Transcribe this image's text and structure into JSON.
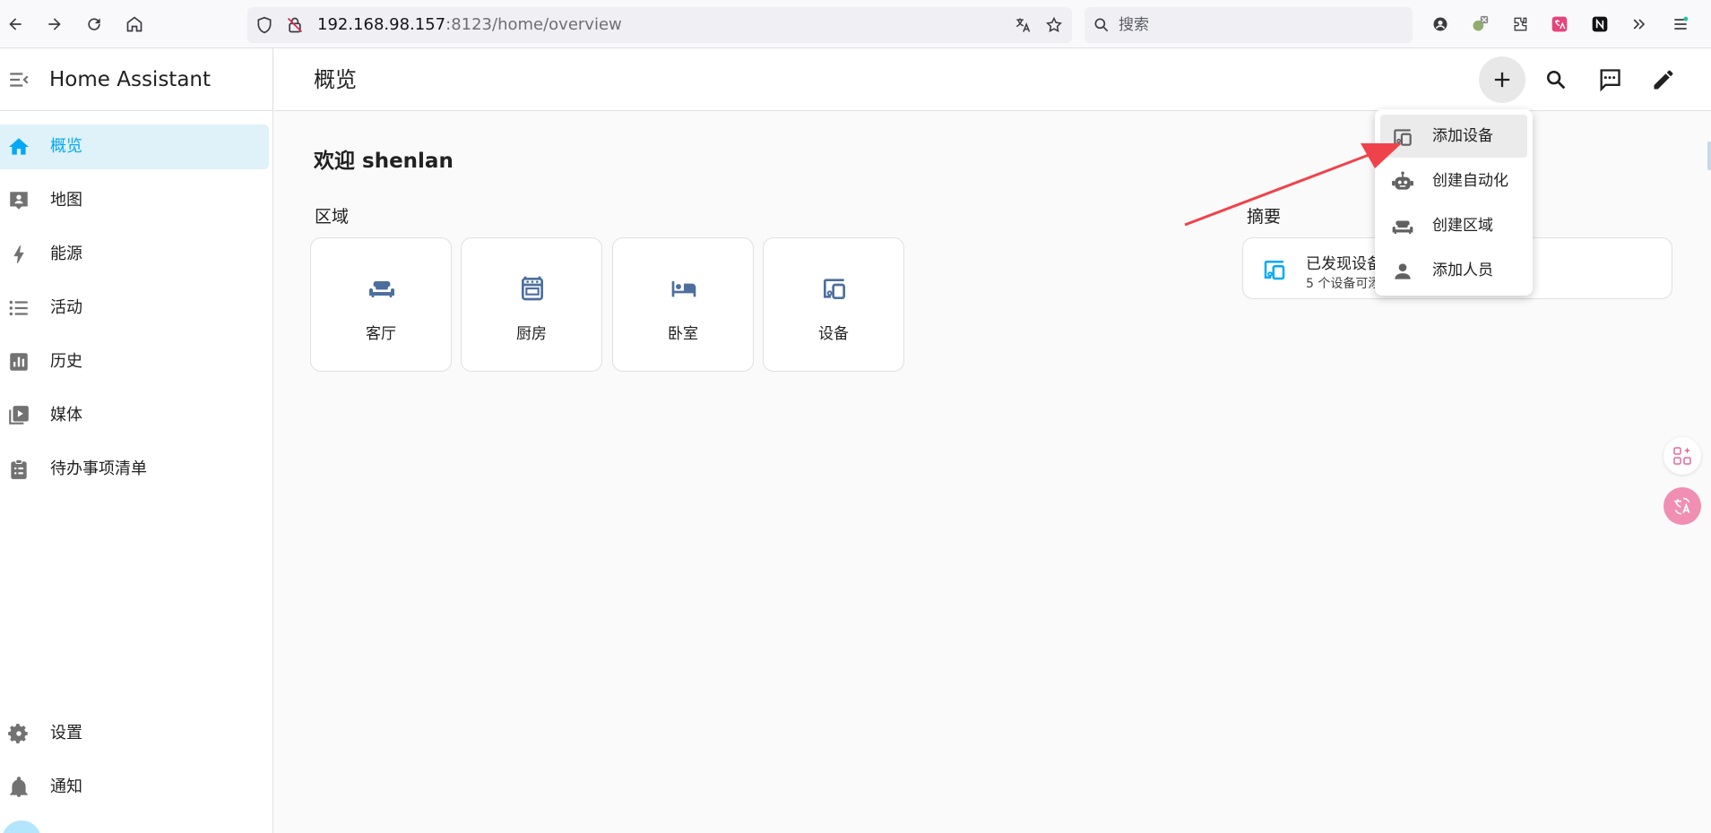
{
  "browser": {
    "url_host": "192.168.98.157",
    "url_path": ":8123/home/overview",
    "search_placeholder": "搜索"
  },
  "sidebar": {
    "title": "Home Assistant",
    "items": [
      {
        "label": "概览",
        "icon": "home-icon",
        "active": true
      },
      {
        "label": "地图",
        "icon": "map-account-icon"
      },
      {
        "label": "能源",
        "icon": "lightning-bolt-icon"
      },
      {
        "label": "活动",
        "icon": "format-list-bulleted-icon"
      },
      {
        "label": "历史",
        "icon": "chart-box-icon"
      },
      {
        "label": "媒体",
        "icon": "play-box-multiple-icon"
      },
      {
        "label": "待办事项清单",
        "icon": "clipboard-list-icon"
      }
    ],
    "bottom_items": [
      {
        "label": "设置",
        "icon": "cog-icon"
      },
      {
        "label": "通知",
        "icon": "bell-icon"
      }
    ]
  },
  "header": {
    "title": "概览"
  },
  "main": {
    "welcome": "欢迎 shenlan",
    "areas_label": "区域",
    "areas": [
      {
        "label": "客厅",
        "icon": "sofa-icon"
      },
      {
        "label": "厨房",
        "icon": "stove-icon"
      },
      {
        "label": "卧室",
        "icon": "bed-icon"
      },
      {
        "label": "设备",
        "icon": "devices-icon"
      }
    ],
    "summary_label": "摘要",
    "summary": {
      "title": "已发现设备",
      "subtitle": "5 个设备可添加"
    }
  },
  "menu": {
    "items": [
      {
        "label": "添加设备",
        "icon": "devices-icon",
        "highlighted": true
      },
      {
        "label": "创建自动化",
        "icon": "robot-icon"
      },
      {
        "label": "创建区域",
        "icon": "sofa-icon"
      },
      {
        "label": "添加人员",
        "icon": "account-icon"
      }
    ]
  },
  "colors": {
    "accent": "#03a9f4",
    "area_icon": "#4c6f9e",
    "arrow": "#f0424a"
  }
}
